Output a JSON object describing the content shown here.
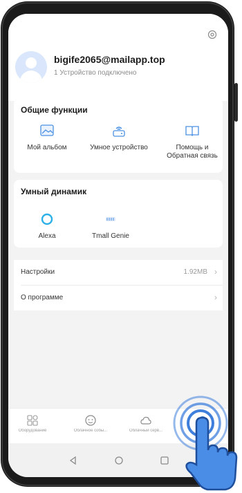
{
  "header": {
    "email": "bigife2065@mailapp.top",
    "devices_status": "1 Устройство подключено"
  },
  "general": {
    "title": "Общие функции",
    "items": [
      {
        "label": "Мой альбом",
        "icon": "album-icon"
      },
      {
        "label": "Умное устройство",
        "icon": "router-icon"
      },
      {
        "label": "Помощь и Обратная связь",
        "icon": "book-icon"
      }
    ]
  },
  "speaker": {
    "title": "Умный динамик",
    "items": [
      {
        "label": "Alexa",
        "icon": "alexa-icon"
      },
      {
        "label": "Tmall Genie",
        "icon": "tmall-genie-icon"
      }
    ]
  },
  "settings": {
    "label": "Настройки",
    "value": "1.92MB"
  },
  "about": {
    "label": "О программе"
  },
  "tabs": [
    {
      "label": "Оборудование",
      "icon": "devices-icon"
    },
    {
      "label": "Облачное собы...",
      "icon": "face-icon"
    },
    {
      "label": "Облачный серв...",
      "icon": "cloud-icon"
    }
  ],
  "colors": {
    "accent": "#4a90e2",
    "background": "#f3f3f4",
    "tap_hand": "#3f7fdc"
  }
}
